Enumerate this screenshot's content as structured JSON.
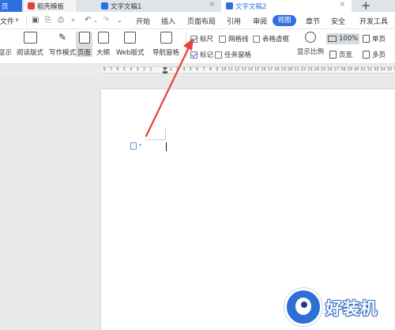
{
  "tabs": {
    "home": "页",
    "templates": "稻壳模板",
    "doc1": "文字文稿1",
    "doc2": "文字文稿2",
    "close": "×",
    "new": "+"
  },
  "menu": {
    "file": "文件",
    "file_caret": "∨",
    "items": [
      "开始",
      "插入",
      "页面布局",
      "引用",
      "审阅",
      "视图",
      "章节",
      "安全",
      "开发工具"
    ],
    "active": "视图"
  },
  "ribbon": {
    "display": "显示",
    "reading": "阅读版式",
    "writing": "写作模式",
    "page": "页面",
    "outline": "大纲",
    "web": "Web版式",
    "nav_pane": "导航窗格",
    "nav_caret": "·",
    "ruler": "标尺",
    "gridlines": "网格线",
    "table_gridlines": "表格虚框",
    "marks": "标记",
    "task_pane": "任务窗格",
    "zoom_label": "显示比例",
    "zoom_value": "100%",
    "single_page": "单页",
    "page_width": "页宽",
    "multi_page": "多页",
    "ruler_checked": true,
    "gridlines_checked": false,
    "table_gridlines_checked": false,
    "marks_checked": true,
    "task_pane_checked": false
  },
  "ruler_ticks": [
    "8",
    "7",
    "6",
    "5",
    "4",
    "3",
    "2",
    "1",
    "",
    "1",
    "2",
    "3",
    "4",
    "5",
    "6",
    "7",
    "8",
    "9",
    "10",
    "11",
    "12",
    "13",
    "14",
    "15",
    "16",
    "17",
    "18",
    "19",
    "20",
    "21",
    "22",
    "23",
    "24",
    "25",
    "26",
    "27",
    "28",
    "29",
    "30",
    "31",
    "32",
    "33",
    "34",
    "35",
    "36"
  ],
  "watermark": {
    "text": "好装机"
  },
  "colors": {
    "accent": "#2f6fe0",
    "arrow": "#e8413d",
    "watermark": "#2d6fd6"
  }
}
